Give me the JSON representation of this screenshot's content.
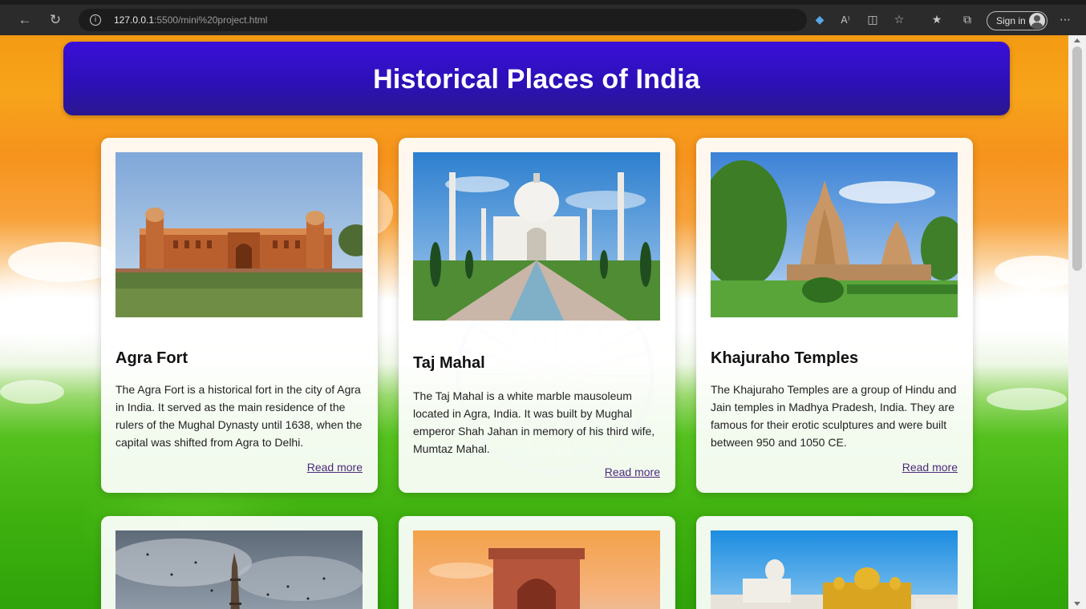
{
  "browser": {
    "url_host": "127.0.0.1",
    "url_path": ":5500/mini%20project.html",
    "sign_in_label": "Sign in"
  },
  "header": {
    "title": "Historical Places of India"
  },
  "cards": [
    {
      "title": "Agra Fort",
      "description": "The Agra Fort is a historical fort in the city of Agra in India. It served as the main residence of the rulers of the Mughal Dynasty until 1638, when the capital was shifted from Agra to Delhi.",
      "link": "Read more"
    },
    {
      "title": "Taj Mahal",
      "description": "The Taj Mahal is a white marble mausoleum located in Agra, India. It was built by Mughal emperor Shah Jahan in memory of his third wife, Mumtaz Mahal.",
      "link": "Read more"
    },
    {
      "title": "Khajuraho Temples",
      "description": "The Khajuraho Temples are a group of Hindu and Jain temples in Madhya Pradesh, India. They are famous for their erotic sculptures and were built between 950 and 1050 CE.",
      "link": "Read more"
    }
  ],
  "colors": {
    "header_bg": "#2d10b8",
    "link": "#4a2a7a",
    "saffron": "#f39a12",
    "green": "#3fb10f"
  },
  "icons": [
    "back-icon",
    "refresh-icon",
    "info-icon",
    "shopping-tag-icon",
    "read-aloud-icon",
    "immersive-reader-icon",
    "add-favorite-icon",
    "favorites-icon",
    "collections-icon",
    "profile-icon",
    "more-icon"
  ]
}
